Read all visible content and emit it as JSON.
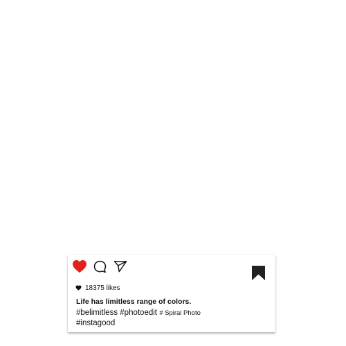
{
  "post": {
    "likes_count_text": "18375 likes",
    "caption_title": "Life has limitless range of colors.",
    "hashtags_main": "#belimitless #photoedit",
    "hashtag_small": "# Spiral Photo",
    "hashtag_second_line": "#instagood"
  },
  "icons": {
    "like": "heart-filled-icon",
    "comment": "speech-bubble-icon",
    "share": "paper-plane-icon",
    "save": "bookmark-icon",
    "likes_indicator": "small-heart-icon"
  },
  "colors": {
    "like_red": "#e4201b",
    "text": "#111111",
    "bookmark": "#222222"
  }
}
